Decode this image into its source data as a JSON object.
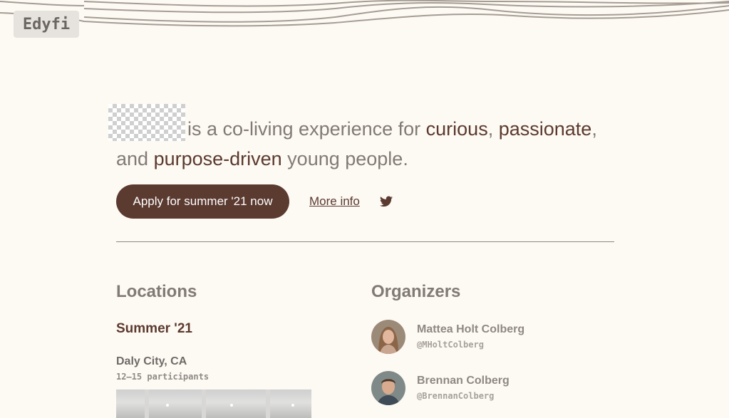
{
  "brand": {
    "logo_text": "Edyfi"
  },
  "hero": {
    "text_1": "is a co-living experience for ",
    "em_1": "curious",
    "text_2": ", ",
    "em_2": "passionate",
    "text_3": ", and ",
    "em_3": "purpose-driven",
    "text_4": " young people."
  },
  "cta": {
    "apply_label": "Apply for summer '21 now",
    "more_info_label": "More info",
    "social_icon": "twitter-icon"
  },
  "locations": {
    "heading": "Locations",
    "season": "Summer '21",
    "city": "Daly City, CA",
    "participants": "12–15 participants"
  },
  "organizers": {
    "heading": "Organizers",
    "people": [
      {
        "name": "Mattea Holt Colberg",
        "handle": "@MHoltColberg"
      },
      {
        "name": "Brennan Colberg",
        "handle": "@BrennanColberg"
      }
    ]
  },
  "colors": {
    "background": "#fdf9f3",
    "accent": "#5b3a30",
    "muted_text": "#827b75"
  }
}
